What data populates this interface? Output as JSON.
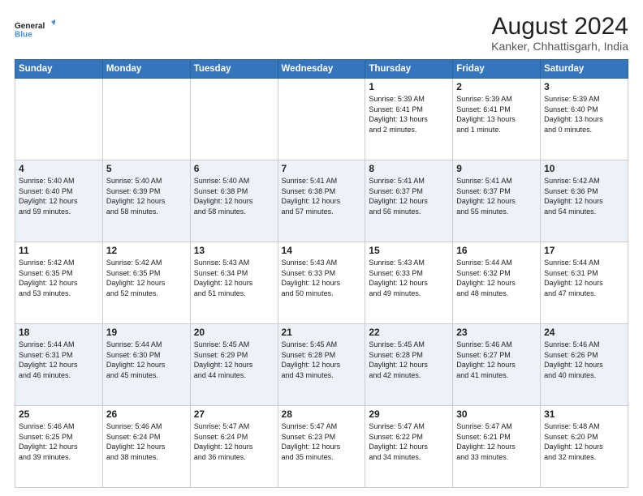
{
  "header": {
    "logo_line1": "General",
    "logo_line2": "Blue",
    "main_title": "August 2024",
    "subtitle": "Kanker, Chhattisgarh, India"
  },
  "days_of_week": [
    "Sunday",
    "Monday",
    "Tuesday",
    "Wednesday",
    "Thursday",
    "Friday",
    "Saturday"
  ],
  "weeks": [
    [
      {
        "day": "",
        "detail": ""
      },
      {
        "day": "",
        "detail": ""
      },
      {
        "day": "",
        "detail": ""
      },
      {
        "day": "",
        "detail": ""
      },
      {
        "day": "1",
        "detail": "Sunrise: 5:39 AM\nSunset: 6:41 PM\nDaylight: 13 hours\nand 2 minutes."
      },
      {
        "day": "2",
        "detail": "Sunrise: 5:39 AM\nSunset: 6:41 PM\nDaylight: 13 hours\nand 1 minute."
      },
      {
        "day": "3",
        "detail": "Sunrise: 5:39 AM\nSunset: 6:40 PM\nDaylight: 13 hours\nand 0 minutes."
      }
    ],
    [
      {
        "day": "4",
        "detail": "Sunrise: 5:40 AM\nSunset: 6:40 PM\nDaylight: 12 hours\nand 59 minutes."
      },
      {
        "day": "5",
        "detail": "Sunrise: 5:40 AM\nSunset: 6:39 PM\nDaylight: 12 hours\nand 58 minutes."
      },
      {
        "day": "6",
        "detail": "Sunrise: 5:40 AM\nSunset: 6:38 PM\nDaylight: 12 hours\nand 58 minutes."
      },
      {
        "day": "7",
        "detail": "Sunrise: 5:41 AM\nSunset: 6:38 PM\nDaylight: 12 hours\nand 57 minutes."
      },
      {
        "day": "8",
        "detail": "Sunrise: 5:41 AM\nSunset: 6:37 PM\nDaylight: 12 hours\nand 56 minutes."
      },
      {
        "day": "9",
        "detail": "Sunrise: 5:41 AM\nSunset: 6:37 PM\nDaylight: 12 hours\nand 55 minutes."
      },
      {
        "day": "10",
        "detail": "Sunrise: 5:42 AM\nSunset: 6:36 PM\nDaylight: 12 hours\nand 54 minutes."
      }
    ],
    [
      {
        "day": "11",
        "detail": "Sunrise: 5:42 AM\nSunset: 6:35 PM\nDaylight: 12 hours\nand 53 minutes."
      },
      {
        "day": "12",
        "detail": "Sunrise: 5:42 AM\nSunset: 6:35 PM\nDaylight: 12 hours\nand 52 minutes."
      },
      {
        "day": "13",
        "detail": "Sunrise: 5:43 AM\nSunset: 6:34 PM\nDaylight: 12 hours\nand 51 minutes."
      },
      {
        "day": "14",
        "detail": "Sunrise: 5:43 AM\nSunset: 6:33 PM\nDaylight: 12 hours\nand 50 minutes."
      },
      {
        "day": "15",
        "detail": "Sunrise: 5:43 AM\nSunset: 6:33 PM\nDaylight: 12 hours\nand 49 minutes."
      },
      {
        "day": "16",
        "detail": "Sunrise: 5:44 AM\nSunset: 6:32 PM\nDaylight: 12 hours\nand 48 minutes."
      },
      {
        "day": "17",
        "detail": "Sunrise: 5:44 AM\nSunset: 6:31 PM\nDaylight: 12 hours\nand 47 minutes."
      }
    ],
    [
      {
        "day": "18",
        "detail": "Sunrise: 5:44 AM\nSunset: 6:31 PM\nDaylight: 12 hours\nand 46 minutes."
      },
      {
        "day": "19",
        "detail": "Sunrise: 5:44 AM\nSunset: 6:30 PM\nDaylight: 12 hours\nand 45 minutes."
      },
      {
        "day": "20",
        "detail": "Sunrise: 5:45 AM\nSunset: 6:29 PM\nDaylight: 12 hours\nand 44 minutes."
      },
      {
        "day": "21",
        "detail": "Sunrise: 5:45 AM\nSunset: 6:28 PM\nDaylight: 12 hours\nand 43 minutes."
      },
      {
        "day": "22",
        "detail": "Sunrise: 5:45 AM\nSunset: 6:28 PM\nDaylight: 12 hours\nand 42 minutes."
      },
      {
        "day": "23",
        "detail": "Sunrise: 5:46 AM\nSunset: 6:27 PM\nDaylight: 12 hours\nand 41 minutes."
      },
      {
        "day": "24",
        "detail": "Sunrise: 5:46 AM\nSunset: 6:26 PM\nDaylight: 12 hours\nand 40 minutes."
      }
    ],
    [
      {
        "day": "25",
        "detail": "Sunrise: 5:46 AM\nSunset: 6:25 PM\nDaylight: 12 hours\nand 39 minutes."
      },
      {
        "day": "26",
        "detail": "Sunrise: 5:46 AM\nSunset: 6:24 PM\nDaylight: 12 hours\nand 38 minutes."
      },
      {
        "day": "27",
        "detail": "Sunrise: 5:47 AM\nSunset: 6:24 PM\nDaylight: 12 hours\nand 36 minutes."
      },
      {
        "day": "28",
        "detail": "Sunrise: 5:47 AM\nSunset: 6:23 PM\nDaylight: 12 hours\nand 35 minutes."
      },
      {
        "day": "29",
        "detail": "Sunrise: 5:47 AM\nSunset: 6:22 PM\nDaylight: 12 hours\nand 34 minutes."
      },
      {
        "day": "30",
        "detail": "Sunrise: 5:47 AM\nSunset: 6:21 PM\nDaylight: 12 hours\nand 33 minutes."
      },
      {
        "day": "31",
        "detail": "Sunrise: 5:48 AM\nSunset: 6:20 PM\nDaylight: 12 hours\nand 32 minutes."
      }
    ]
  ]
}
